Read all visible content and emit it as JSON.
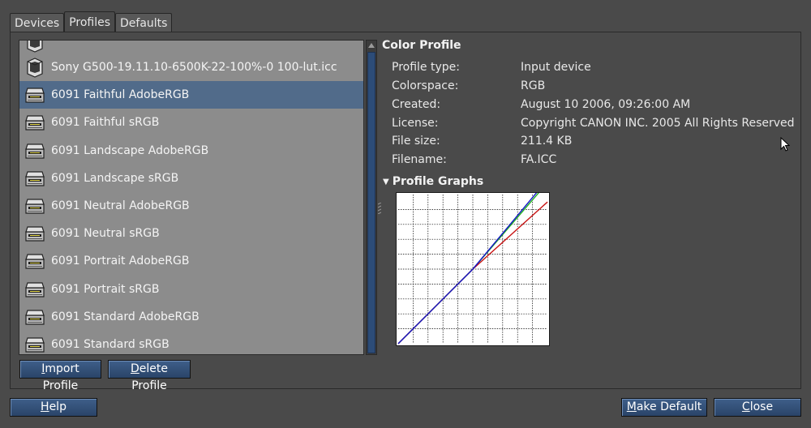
{
  "tabs": [
    {
      "label": "Devices",
      "active": false
    },
    {
      "label": "Profiles",
      "active": true
    },
    {
      "label": "Defaults",
      "active": false
    }
  ],
  "profiles": {
    "items": [
      {
        "label": "",
        "icon": "monitor-icon"
      },
      {
        "label": "Sony G500-19.11.10-6500K-22-100%-0 100-lut.icc",
        "icon": "monitor-icon"
      },
      {
        "label": "6091 Faithful AdobeRGB",
        "icon": "scanner-icon",
        "selected": true
      },
      {
        "label": "6091 Faithful sRGB",
        "icon": "scanner-icon"
      },
      {
        "label": "6091 Landscape AdobeRGB",
        "icon": "scanner-icon"
      },
      {
        "label": "6091 Landscape sRGB",
        "icon": "scanner-icon"
      },
      {
        "label": "6091 Neutral AdobeRGB",
        "icon": "scanner-icon"
      },
      {
        "label": "6091 Neutral sRGB",
        "icon": "scanner-icon"
      },
      {
        "label": "6091 Portrait AdobeRGB",
        "icon": "scanner-icon"
      },
      {
        "label": "6091 Portrait sRGB",
        "icon": "scanner-icon"
      },
      {
        "label": "6091 Standard AdobeRGB",
        "icon": "scanner-icon"
      },
      {
        "label": "6091 Standard sRGB",
        "icon": "scanner-icon"
      }
    ]
  },
  "color_profile": {
    "title": "Color Profile",
    "rows": [
      {
        "key": "Profile type:",
        "value": "Input device"
      },
      {
        "key": "Colorspace:",
        "value": "RGB"
      },
      {
        "key": "Created:",
        "value": "August 10 2006, 09:26:00 AM"
      },
      {
        "key": "License:",
        "value": "Copyright CANON INC. 2005 All Rights Reserved"
      },
      {
        "key": "File size:",
        "value": "211.4 KB"
      },
      {
        "key": "Filename:",
        "value": "FA.ICC"
      }
    ]
  },
  "profile_graphs": {
    "title": "Profile Graphs",
    "expanded": true,
    "colors": {
      "red": "#c81414",
      "green": "#20b020",
      "blue": "#1414c8",
      "grid": "#000000"
    },
    "curves": {
      "red": [
        [
          0,
          0
        ],
        [
          0.5,
          0.5
        ],
        [
          1,
          0.95
        ]
      ],
      "green": [
        [
          0,
          0
        ],
        [
          0.5,
          0.5
        ],
        [
          1,
          1.08
        ]
      ],
      "blue": [
        [
          0,
          0
        ],
        [
          0.5,
          0.5
        ],
        [
          1,
          1.1
        ]
      ]
    },
    "grid_divisions": 10
  },
  "buttons": {
    "import_mnemonic": "I",
    "import_rest": "mport Profile",
    "delete_mnemonic": "D",
    "delete_rest": "elete Profile",
    "help_mnemonic": "H",
    "help_rest": "elp",
    "make_default_mnemonic": "M",
    "make_default_rest": "ake Default",
    "close_mnemonic": "C",
    "close_rest": "lose"
  },
  "theme": {
    "background": "#4a4a4a",
    "list_background": "#8c8c8c",
    "selection": "#516b8a",
    "button": "#2f4c75"
  }
}
